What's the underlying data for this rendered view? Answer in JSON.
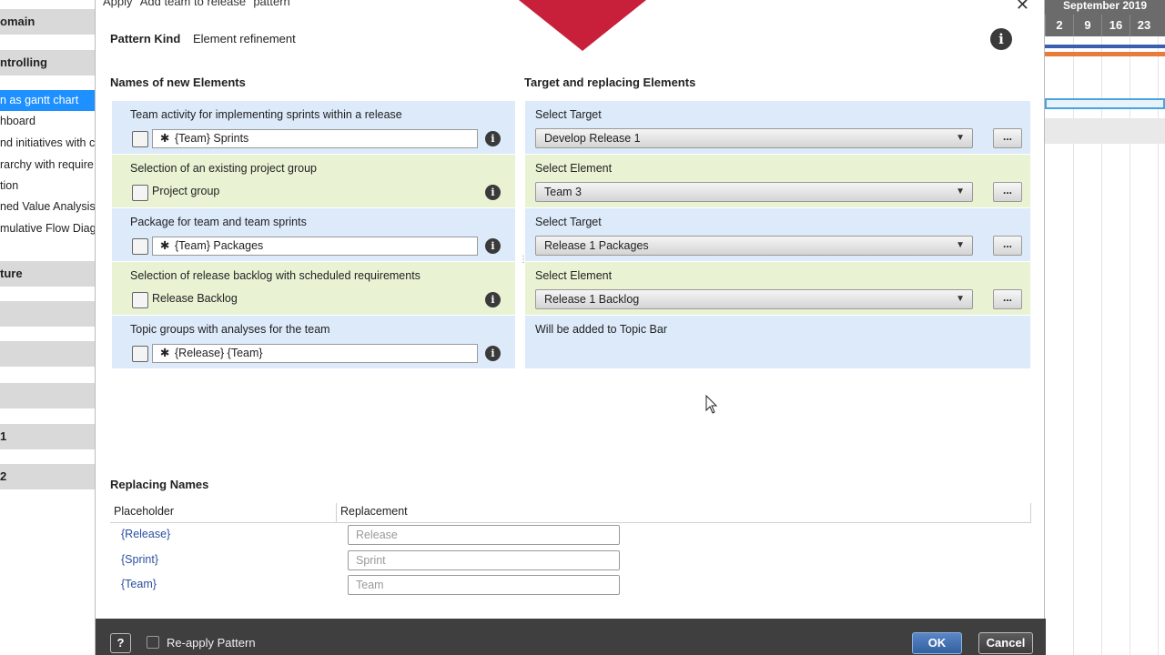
{
  "background_sidebar": {
    "items": [
      {
        "text": "omain",
        "kind": "head"
      },
      {
        "text": "ntrolling",
        "kind": "head"
      },
      {
        "text": "n as gantt chart",
        "kind": "selected"
      },
      {
        "text": "hboard",
        "kind": "item"
      },
      {
        "text": "nd initiatives with c",
        "kind": "item"
      },
      {
        "text": "rarchy with require",
        "kind": "item"
      },
      {
        "text": "tion",
        "kind": "item"
      },
      {
        "text": "ned Value Analysis",
        "kind": "item"
      },
      {
        "text": "mulative Flow Diag",
        "kind": "item"
      },
      {
        "text": "ture",
        "kind": "head"
      },
      {
        "text": "",
        "kind": "head"
      },
      {
        "text": "",
        "kind": "head"
      },
      {
        "text": "",
        "kind": "head"
      },
      {
        "text": "1",
        "kind": "head"
      },
      {
        "text": "2",
        "kind": "head"
      }
    ]
  },
  "background_gantt": {
    "month": "September 2019",
    "days": [
      "2",
      "9",
      "16",
      "23"
    ]
  },
  "dialog": {
    "title": "Apply \"Add team to release\" pattern",
    "close_glyph": "✕",
    "pattern_kind_label": "Pattern Kind",
    "pattern_kind_value": "Element refinement",
    "info_glyph": "i",
    "names_heading": "Names of new Elements",
    "targets_heading": "Target and replacing Elements",
    "rows": [
      {
        "label": "Team activity for implementing sprints within a release",
        "icon": "team-activity-icon",
        "value": "{Team} Sprints",
        "editable": true,
        "right_label": "Select Target",
        "right_value": "Develop Release 1",
        "right_kind": "select"
      },
      {
        "label": "Selection of an existing project group",
        "icon": "project-group-icon",
        "value": "Project group",
        "editable": false,
        "right_label": "Select Element",
        "right_value": "Team 3",
        "right_kind": "select"
      },
      {
        "label": "Package for team and team sprints",
        "icon": "package-icon",
        "value": "{Team} Packages",
        "editable": true,
        "right_label": "Select Target",
        "right_value": "Release 1 Packages",
        "right_kind": "select"
      },
      {
        "label": "Selection of release backlog with scheduled requirements",
        "icon": "backlog-icon",
        "value": "Release Backlog",
        "editable": false,
        "right_label": "Select Element",
        "right_value": "Release 1 Backlog",
        "right_kind": "select"
      },
      {
        "label": "Topic groups with analyses for the team",
        "icon": "topic-group-icon",
        "value": "{Release} {Team}",
        "editable": true,
        "right_label": "Will be added to Topic Bar",
        "right_value": "",
        "right_kind": "text"
      }
    ],
    "star_glyph": "✱",
    "dropdown_caret": "▼",
    "browse_label": "...",
    "replacing_heading": "Replacing Names",
    "replacing_columns": {
      "placeholder": "Placeholder",
      "replacement": "Replacement"
    },
    "replacements": [
      {
        "placeholder": "{Release}",
        "input_placeholder": "Release"
      },
      {
        "placeholder": "{Sprint}",
        "input_placeholder": "Sprint"
      },
      {
        "placeholder": "{Team}",
        "input_placeholder": "Team"
      }
    ],
    "footer": {
      "help_label": "?",
      "reapply_label": "Re-apply Pattern",
      "reapply_checked": false,
      "ok_label": "OK",
      "cancel_label": "Cancel"
    }
  },
  "colors": {
    "row_blue": "#dceafa",
    "row_green": "#e9f3d4",
    "footer_bg": "#3f3f3f",
    "ok_blue": "#3f6db0",
    "placeholder_blue": "#2a4fa0",
    "marker_red": "#c8203a",
    "selected_blue": "#1e90ff"
  }
}
